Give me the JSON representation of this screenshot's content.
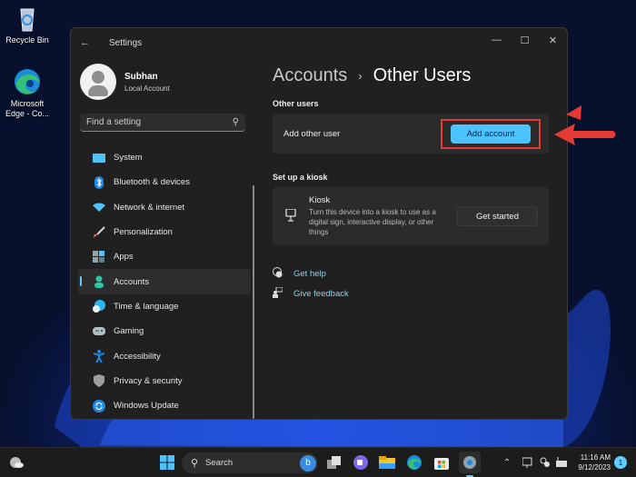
{
  "desktop": {
    "icons": [
      {
        "label": "Recycle Bin",
        "icon": "recycle-bin-icon"
      },
      {
        "label": "Microsoft Edge - Co...",
        "icon": "edge-icon"
      }
    ]
  },
  "window": {
    "title": "Settings",
    "controls": {
      "minimize": "—",
      "maximize": "☐",
      "close": "✕"
    }
  },
  "profile": {
    "name": "Subhan",
    "type": "Local Account"
  },
  "search": {
    "placeholder": "Find a setting"
  },
  "nav": {
    "items": [
      {
        "label": "System",
        "icon": "system-icon",
        "color": "#4fc3f7"
      },
      {
        "label": "Bluetooth & devices",
        "icon": "bluetooth-icon",
        "color": "#1e88e5"
      },
      {
        "label": "Network & internet",
        "icon": "wifi-icon",
        "color": "#4fc3f7"
      },
      {
        "label": "Personalization",
        "icon": "brush-icon",
        "color": "#ff8a50"
      },
      {
        "label": "Apps",
        "icon": "apps-icon",
        "color": "#90a4ae"
      },
      {
        "label": "Accounts",
        "icon": "accounts-icon",
        "color": "#2ec4a6",
        "active": true
      },
      {
        "label": "Time & language",
        "icon": "globe-clock-icon",
        "color": "#29b6f6"
      },
      {
        "label": "Gaming",
        "icon": "gamepad-icon",
        "color": "#b0bec5"
      },
      {
        "label": "Accessibility",
        "icon": "accessibility-icon",
        "color": "#1e88e5"
      },
      {
        "label": "Privacy & security",
        "icon": "shield-icon",
        "color": "#9e9e9e"
      },
      {
        "label": "Windows Update",
        "icon": "update-icon",
        "color": "#1e88e5"
      }
    ]
  },
  "main": {
    "breadcrumb_parent": "Accounts",
    "breadcrumb_separator": "›",
    "breadcrumb_current": "Other Users",
    "other_users": {
      "heading": "Other users",
      "row_label": "Add other user",
      "button": "Add account"
    },
    "kiosk": {
      "heading": "Set up a kiosk",
      "title": "Kiosk",
      "description": "Turn this device into a kiosk to use as a digital sign, interactive display, or other things",
      "button": "Get started"
    },
    "links": [
      {
        "label": "Get help",
        "icon": "help-icon"
      },
      {
        "label": "Give feedback",
        "icon": "feedback-icon"
      }
    ]
  },
  "annotation": {
    "color": "#e53935"
  },
  "taskbar": {
    "search_label": "Search",
    "time": "11:16 AM",
    "date": "9/12/2023",
    "notification_count": "1",
    "accent": "#60cdff"
  }
}
